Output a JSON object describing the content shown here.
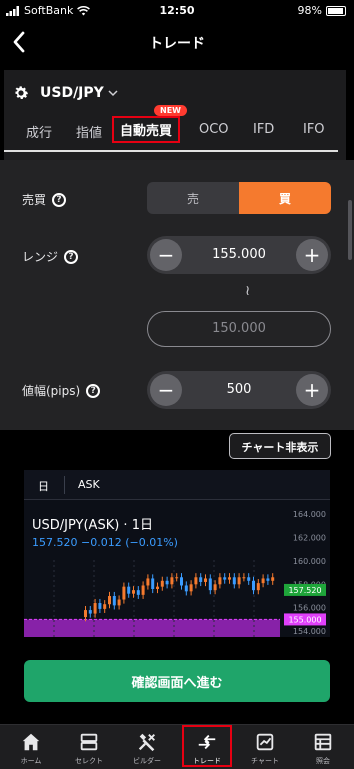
{
  "status": {
    "carrier": "SoftBank",
    "time": "12:50",
    "battery": "98%"
  },
  "navbar": {
    "title": "トレード"
  },
  "symbol": {
    "pair": "USD/JPY"
  },
  "order_tabs": {
    "new_badge": "NEW",
    "items": [
      {
        "label": "成行"
      },
      {
        "label": "指値"
      },
      {
        "label": "自動売買"
      },
      {
        "label": "OCO"
      },
      {
        "label": "IFD"
      },
      {
        "label": "IFO"
      }
    ],
    "active": "自動売買"
  },
  "form": {
    "side": {
      "label": "売買",
      "sell": "売",
      "buy": "買",
      "selected": "買"
    },
    "range": {
      "label": "レンジ",
      "upper": "155.000",
      "tilde": "≀",
      "lower": "150.000"
    },
    "width": {
      "label": "値幅(pips)",
      "value": "500"
    },
    "minus": "−",
    "plus": "+",
    "help": "?"
  },
  "chart_toggle": "チャート非表示",
  "chart": {
    "period": "日",
    "side": "ASK",
    "title": "USD/JPY(ASK) · 1日",
    "quote": "157.520  −0.012 (−0.01%)",
    "colors": {
      "up": "#f57a2e",
      "down": "#3b9cff",
      "band": "#b02ad9",
      "last_price": "#1fa53a",
      "limit_line": "#e040fb"
    }
  },
  "chart_data": {
    "type": "candlestick",
    "y_ticks": [
      "164.000",
      "162.000",
      "160.000",
      "158.000",
      "156.000",
      "154.000"
    ],
    "price_tags": [
      {
        "label": "157.520",
        "color": "#1fa53a"
      },
      {
        "label": "155.000",
        "color": "#e040fb"
      }
    ],
    "y_range": [
      153.5,
      165.2
    ]
  },
  "confirm_button": "確認画面へ進む",
  "tabbar": {
    "items": [
      {
        "label": "ホーム",
        "icon": "home-icon"
      },
      {
        "label": "セレクト",
        "icon": "select-icon"
      },
      {
        "label": "ビルダー",
        "icon": "builder-icon"
      },
      {
        "label": "トレード",
        "icon": "trade-icon"
      },
      {
        "label": "チャート",
        "icon": "chart-icon"
      },
      {
        "label": "照会",
        "icon": "inquiry-icon"
      }
    ],
    "active": "トレード"
  }
}
